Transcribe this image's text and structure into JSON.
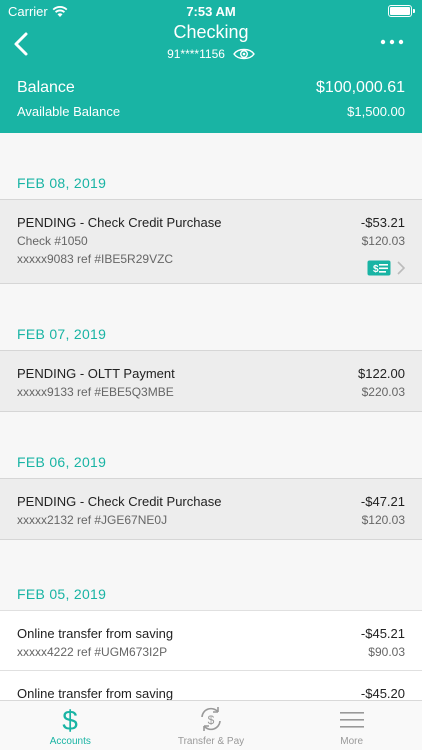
{
  "status": {
    "carrier": "Carrier",
    "time": "7:53 AM"
  },
  "header": {
    "title": "Checking",
    "account_masked": "91****1156"
  },
  "balances": {
    "balance_label": "Balance",
    "balance_value": "$100,000.61",
    "available_label": "Available Balance",
    "available_value": "$1,500.00"
  },
  "groups": [
    {
      "date": "FEB 08, 2019",
      "transactions": [
        {
          "title": "PENDING - Check Credit Purchase",
          "amount": "-$53.21",
          "line2_left": "Check #1050",
          "line2_right": "$120.03",
          "line3_left": "xxxxx9083 ref #IBE5R29VZC",
          "has_check": true
        }
      ]
    },
    {
      "date": "FEB 07, 2019",
      "transactions": [
        {
          "title": "PENDING - OLTT Payment",
          "amount": "$122.00",
          "line2_left": "xxxxx9133 ref #EBE5Q3MBE",
          "line2_right": "$220.03"
        }
      ]
    },
    {
      "date": "FEB 06, 2019",
      "transactions": [
        {
          "title": "PENDING - Check Credit Purchase",
          "amount": "-$47.21",
          "line2_left": "xxxxx2132 ref #JGE67NE0J",
          "line2_right": "$120.03"
        }
      ]
    },
    {
      "date": "FEB 05, 2019",
      "transactions": [
        {
          "title": "Online transfer from saving",
          "amount": "-$45.21",
          "line2_left": "xxxxx4222 ref #UGM673I2P",
          "line2_right": "$90.03"
        },
        {
          "title": "Online transfer from saving",
          "amount": "-$45.20",
          "line2_left": "",
          "line2_right": ""
        }
      ]
    }
  ],
  "tabs": [
    {
      "label": "Accounts",
      "active": true
    },
    {
      "label": "Transfer & Pay",
      "active": false
    },
    {
      "label": "More",
      "active": false
    }
  ],
  "colors": {
    "accent": "#19b4a4"
  }
}
